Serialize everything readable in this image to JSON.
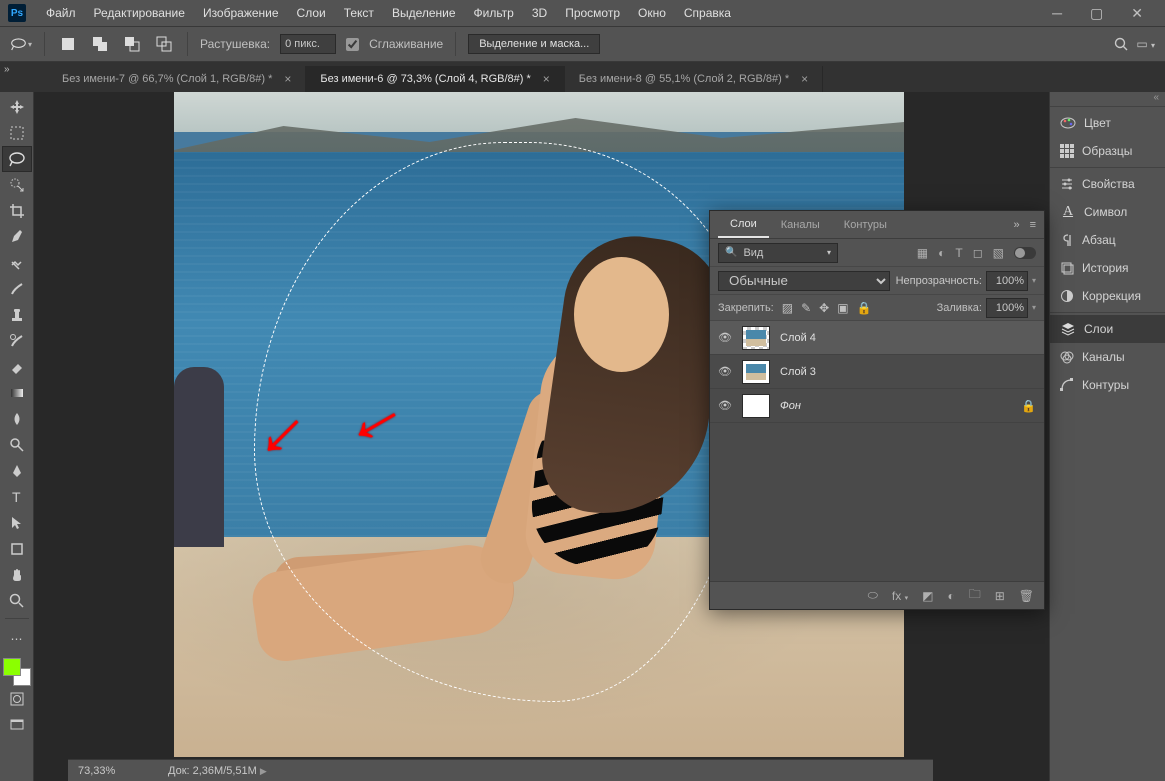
{
  "menubar": {
    "items": [
      "Файл",
      "Редактирование",
      "Изображение",
      "Слои",
      "Текст",
      "Выделение",
      "Фильтр",
      "3D",
      "Просмотр",
      "Окно",
      "Справка"
    ]
  },
  "optbar": {
    "feather_label": "Растушевка:",
    "feather_value": "0 пикс.",
    "antialias_label": "Сглаживание",
    "select_mask_label": "Выделение и маска..."
  },
  "tabs": [
    {
      "label": "Без имени-7 @ 66,7% (Слой 1, RGB/8#) *",
      "active": false
    },
    {
      "label": "Без имени-6 @ 73,3% (Слой 4, RGB/8#) *",
      "active": true
    },
    {
      "label": "Без имени-8 @ 55,1% (Слой 2, RGB/8#) *",
      "active": false
    }
  ],
  "status": {
    "zoom": "73,33%",
    "doc_label": "Док:",
    "doc_value": "2,36M/5,51M"
  },
  "dock": {
    "sections": [
      [
        {
          "label": "Цвет",
          "icon": "palette"
        },
        {
          "label": "Образцы",
          "icon": "grid"
        }
      ],
      [
        {
          "label": "Свойства",
          "icon": "sliders"
        },
        {
          "label": "Символ",
          "icon": "A"
        },
        {
          "label": "Абзац",
          "icon": "para"
        },
        {
          "label": "История",
          "icon": "history"
        },
        {
          "label": "Коррекция",
          "icon": "adjust"
        }
      ],
      [
        {
          "label": "Слои",
          "icon": "layers",
          "active": true
        },
        {
          "label": "Каналы",
          "icon": "channels"
        },
        {
          "label": "Контуры",
          "icon": "paths"
        }
      ]
    ]
  },
  "layers_panel": {
    "tabs": [
      "Слои",
      "Каналы",
      "Контуры"
    ],
    "active_tab": 0,
    "search_kind": "Вид",
    "blend_mode": "Обычные",
    "opacity_label": "Непрозрачность:",
    "opacity_value": "100%",
    "lock_label": "Закрепить:",
    "fill_label": "Заливка:",
    "fill_value": "100%",
    "layers": [
      {
        "name": "Слой 4",
        "selected": true,
        "thumb": "checker",
        "italic": false
      },
      {
        "name": "Слой 3",
        "selected": false,
        "thumb": "photo",
        "italic": false
      },
      {
        "name": "Фон",
        "selected": false,
        "thumb": "white",
        "locked": true,
        "italic": true
      }
    ]
  },
  "colors": {
    "foreground": "#8bff00",
    "background": "#ffffff"
  }
}
